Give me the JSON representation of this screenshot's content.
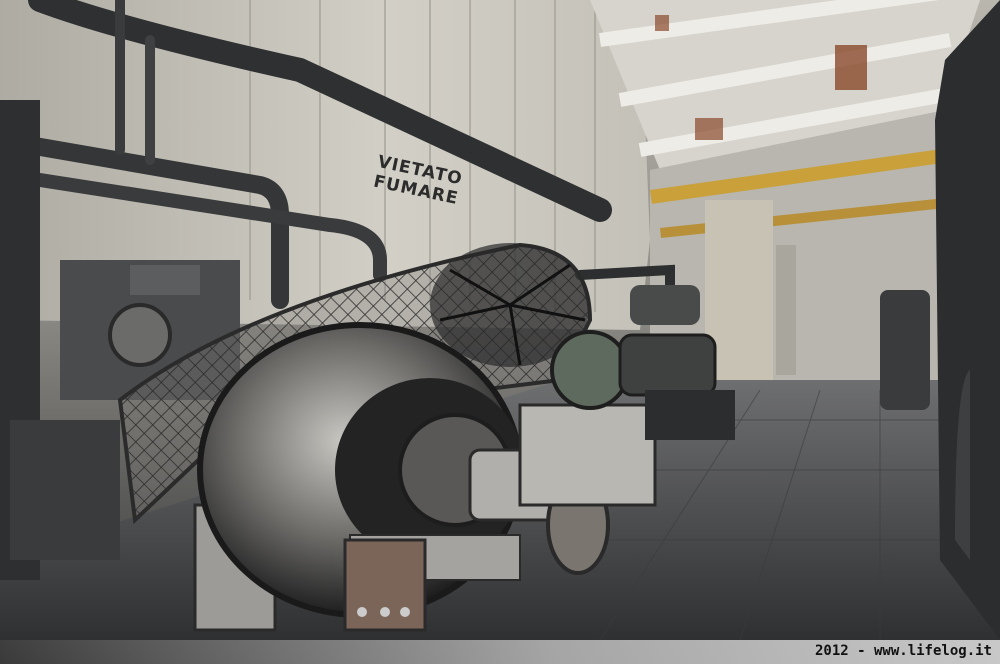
{
  "photo": {
    "sign_text": "VIETATO\nFUMARE",
    "credit": "2012 - www.lifelog.it"
  },
  "colors": {
    "wall": "#c9c6bd",
    "ceiling": "#d8d6cf",
    "floor": "#4a4b4c",
    "machine": "#2a2b2d",
    "rust": "#8a4a2c",
    "yellow_pipe": "#c9a03a"
  }
}
